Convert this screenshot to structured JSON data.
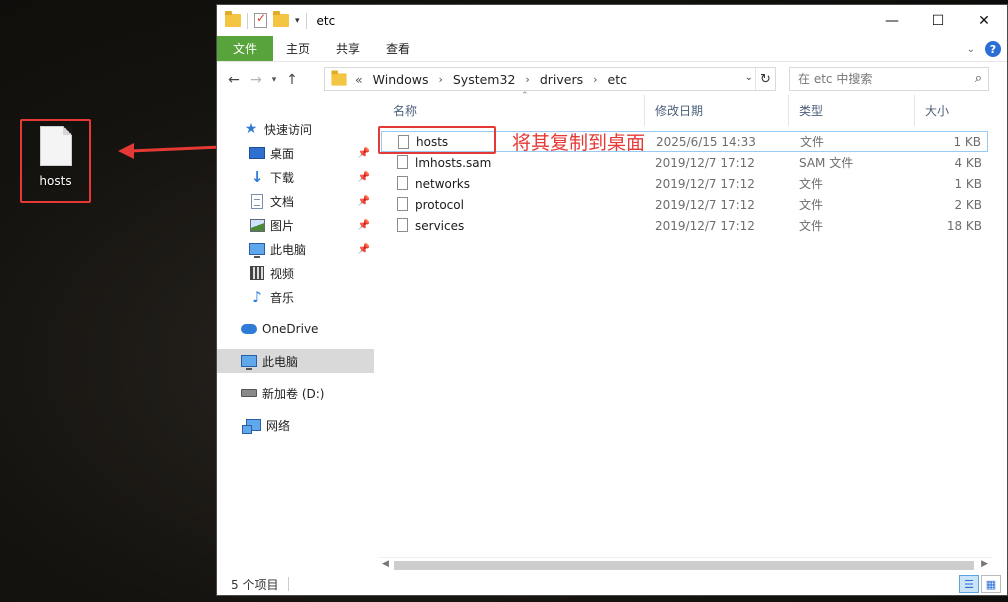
{
  "desktop": {
    "icon_label": "hosts"
  },
  "window": {
    "title": "etc",
    "ribbon_tabs": [
      "文件",
      "主页",
      "共享",
      "查看"
    ],
    "address": {
      "overflow": "«",
      "crumbs": [
        "Windows",
        "System32",
        "drivers",
        "etc"
      ]
    },
    "search": {
      "placeholder": "在 etc 中搜索"
    },
    "nav": [
      {
        "label": "快速访问",
        "icon": "star-icon",
        "pinned": false
      },
      {
        "label": "桌面",
        "icon": "desktop-icon",
        "pinned": true
      },
      {
        "label": "下载",
        "icon": "download-icon",
        "pinned": true
      },
      {
        "label": "文档",
        "icon": "document-icon",
        "pinned": true
      },
      {
        "label": "图片",
        "icon": "picture-icon",
        "pinned": true
      },
      {
        "label": "此电脑",
        "icon": "computer-icon",
        "pinned": true
      },
      {
        "label": "视频",
        "icon": "video-icon",
        "pinned": false
      },
      {
        "label": "音乐",
        "icon": "music-icon",
        "pinned": false
      },
      {
        "label": "OneDrive",
        "icon": "cloud-icon",
        "pinned": false
      },
      {
        "label": "此电脑",
        "icon": "computer-icon",
        "pinned": false,
        "selected": true
      },
      {
        "label": "新加卷 (D:)",
        "icon": "drive-icon",
        "pinned": false
      },
      {
        "label": "网络",
        "icon": "network-icon",
        "pinned": false
      }
    ],
    "columns": {
      "name": "名称",
      "date": "修改日期",
      "type": "类型",
      "size": "大小"
    },
    "files": [
      {
        "name": "hosts",
        "date": "2025/6/15 14:33",
        "type": "文件",
        "size": "1 KB",
        "selected": true
      },
      {
        "name": "lmhosts.sam",
        "date": "2019/12/7 17:12",
        "type": "SAM 文件",
        "size": "4 KB"
      },
      {
        "name": "networks",
        "date": "2019/12/7 17:12",
        "type": "文件",
        "size": "1 KB"
      },
      {
        "name": "protocol",
        "date": "2019/12/7 17:12",
        "type": "文件",
        "size": "2 KB"
      },
      {
        "name": "services",
        "date": "2019/12/7 17:12",
        "type": "文件",
        "size": "18 KB"
      }
    ],
    "status": "5 个项目"
  },
  "annotation": {
    "text": "将其复制到桌面",
    "color": "#e53935"
  },
  "colors": {
    "file_tab": "#58a33b",
    "accent": "#2f7bd8",
    "selection": "#d9d9d9"
  }
}
